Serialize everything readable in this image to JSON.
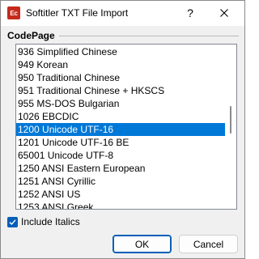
{
  "window": {
    "icon_text": "Ec",
    "title": "Softitler TXT File Import",
    "help_label": "?"
  },
  "codepage": {
    "group_label": "CodePage",
    "items": [
      "936 Simplified Chinese",
      "949 Korean",
      "950 Traditional Chinese",
      "951 Traditional Chinese + HKSCS",
      "955 MS-DOS Bulgarian",
      "1026 EBCDIC",
      "1200 Unicode UTF-16",
      "1201 Unicode UTF-16 BE",
      "65001 Unicode UTF-8",
      "1250 ANSI Eastern European",
      "1251 ANSI Cyrillic",
      "1252 ANSI US",
      "1253 ANSI Greek"
    ],
    "selected_index": 6,
    "scroll_position": 0.45
  },
  "options": {
    "include_italics_label": "Include Italics",
    "include_italics_checked": true
  },
  "buttons": {
    "ok_label": "OK",
    "cancel_label": "Cancel"
  },
  "colors": {
    "selection": "#0078d7",
    "accent": "#005fb8"
  }
}
